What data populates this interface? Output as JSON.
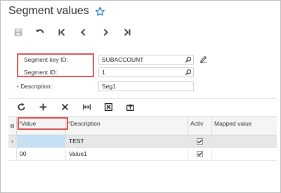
{
  "header": {
    "title": "Segment values"
  },
  "form": {
    "segment_key_label": "Segment key ID:",
    "segment_key_value": "SUBACCOUNT",
    "segment_id_label": "Segment ID:",
    "segment_id_value": "1",
    "description_label": "Description:",
    "description_value": "Seg1"
  },
  "grid": {
    "columns": {
      "value": "Value",
      "description": "Description",
      "active": "Activ",
      "mapped": "Mapped value"
    },
    "rows": [
      {
        "value": "",
        "description": "TEST",
        "active": true,
        "mapped": ""
      },
      {
        "value": "00",
        "description": "Value1",
        "active": true,
        "mapped": ""
      }
    ]
  },
  "colors": {
    "accent": "#1a73c8",
    "highlight": "#d9534f",
    "selected_cell": "#c5e0f5"
  }
}
